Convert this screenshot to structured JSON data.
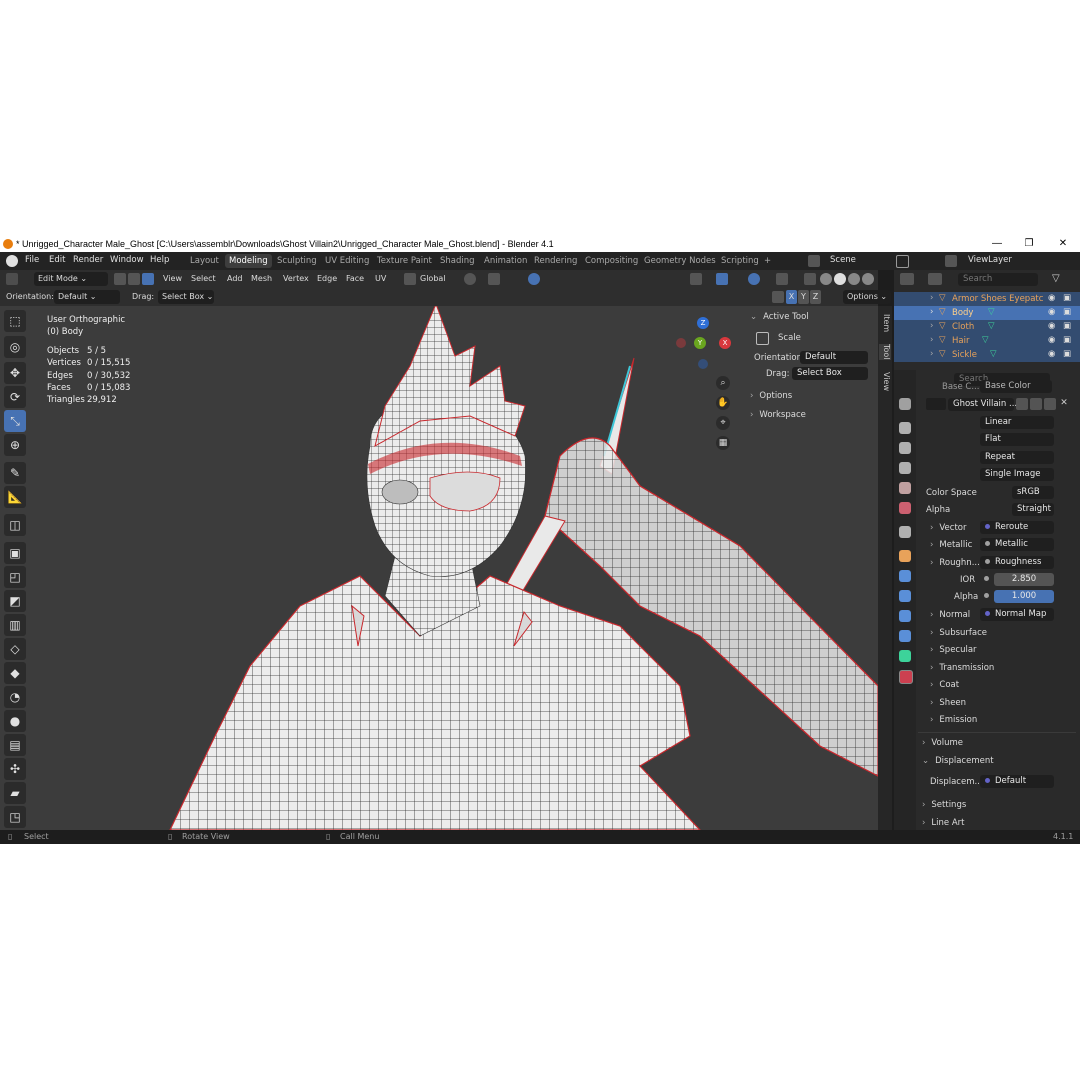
{
  "window": {
    "title": "* Unrigged_Character Male_Ghost [C:\\Users\\assemblr\\Downloads\\Ghost Villain2\\Unrigged_Character Male_Ghost.blend] - Blender 4.1",
    "minimize": "—",
    "maximize": "❐",
    "close": "✕"
  },
  "menu": {
    "items": [
      "File",
      "Edit",
      "Render",
      "Window",
      "Help"
    ],
    "workspaces": [
      "Layout",
      "Modeling",
      "Sculpting",
      "UV Editing",
      "Texture Paint",
      "Shading",
      "Animation",
      "Rendering",
      "Compositing",
      "Geometry Nodes",
      "Scripting",
      "+"
    ],
    "active_workspace": "Modeling",
    "scene": "Scene",
    "view_layer": "ViewLayer"
  },
  "header": {
    "mode": "Edit Mode",
    "menus": [
      "View",
      "Select",
      "Add",
      "Mesh",
      "Vertex",
      "Edge",
      "Face",
      "UV"
    ],
    "transform_orientation": "Global",
    "orientation_label": "Orientation:",
    "orientation_value": "Default",
    "drag_label": "Drag:",
    "drag_value": "Select Box",
    "axes": [
      "X",
      "Y",
      "Z"
    ],
    "options": "Options"
  },
  "viewport": {
    "view_name": "User Orthographic",
    "object_name": "(0) Body",
    "stats": [
      {
        "label": "Objects",
        "value": "5 / 5"
      },
      {
        "label": "Vertices",
        "value": "0 / 15,515"
      },
      {
        "label": "Edges",
        "value": "0 / 30,532"
      },
      {
        "label": "Faces",
        "value": "0 / 15,083"
      },
      {
        "label": "Triangles",
        "value": "29,912"
      }
    ],
    "gizmo": {
      "x": "X",
      "y": "Y",
      "z": "Z"
    }
  },
  "npanel": {
    "title": "Active Tool",
    "tool": "Scale",
    "orientation_label": "Orientation",
    "orientation_value": "Default",
    "drag_label": "Drag:",
    "drag_value": "Select Box",
    "sections": [
      "Options",
      "Workspace"
    ],
    "tabs": [
      "Item",
      "Tool",
      "View"
    ]
  },
  "outliner": {
    "search_placeholder": "Search",
    "items": [
      "Armor Shoes Eyepatc",
      "Body",
      "Cloth",
      "Hair",
      "Sickle"
    ]
  },
  "properties": {
    "search_placeholder": "Search",
    "partial_row": {
      "label": "Base C...",
      "value": "Base Color"
    },
    "material_name": "Ghost Villain ...",
    "interp": "Linear",
    "projection": "Flat",
    "extension": "Repeat",
    "source": "Single Image",
    "color_space_label": "Color Space",
    "color_space": "sRGB",
    "alpha_mode_label": "Alpha",
    "alpha_mode": "Straight",
    "inputs": [
      {
        "label": "Vector",
        "value": "Reroute"
      },
      {
        "label": "Metallic",
        "value": "Metallic"
      },
      {
        "label": "Roughn...",
        "value": "Roughness"
      }
    ],
    "ior_label": "IOR",
    "ior": "2.850",
    "alpha_label": "Alpha",
    "alpha": "1.000",
    "normal_label": "Normal",
    "normal_value": "Normal Map",
    "panels": [
      "Subsurface",
      "Specular",
      "Transmission",
      "Coat",
      "Sheen",
      "Emission"
    ],
    "volume": "Volume",
    "displacement": "Displacement",
    "displacement_label": "Displacem...",
    "displacement_value": "Default",
    "settings": "Settings",
    "line_art": "Line Art"
  },
  "status": {
    "select": "Select",
    "rotate": "Rotate View",
    "call_menu": "Call Menu",
    "version": "4.1.1"
  },
  "colors": {
    "accent": "#4772b3",
    "object_orange": "#e8a25a",
    "mesh_edge_red": "#c8282d",
    "selection_row": "#334c70"
  }
}
